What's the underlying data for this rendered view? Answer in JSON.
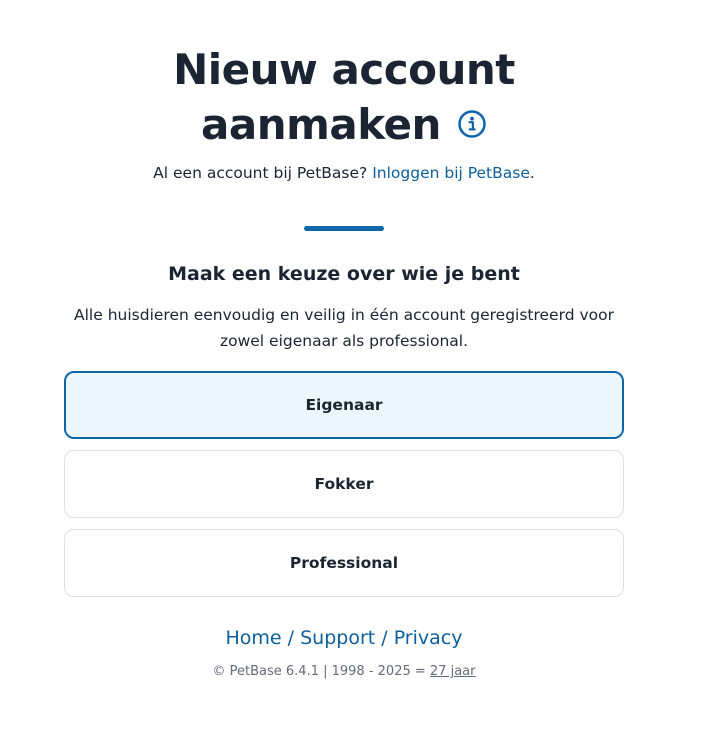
{
  "header": {
    "title_line1": "Nieuw account",
    "title_line2": "aanmaken",
    "info_icon": "info-circle-icon"
  },
  "login_prompt": {
    "text": "Al een account bij PetBase? ",
    "link": "Inloggen bij PetBase",
    "suffix": "."
  },
  "choice": {
    "heading": "Maak een keuze over wie je bent",
    "description": "Alle huisdieren eenvoudig en veilig in één account geregistreerd voor zowel eigenaar als professional.",
    "options": [
      {
        "label": "Eigenaar",
        "selected": true
      },
      {
        "label": "Fokker",
        "selected": false
      },
      {
        "label": "Professional",
        "selected": false
      }
    ]
  },
  "footer": {
    "links": [
      "Home",
      "Support",
      "Privacy"
    ],
    "separator": " / ",
    "copyright": "© PetBase 6.4.1 | 1998 - 2025 = ",
    "years": "27 jaar"
  },
  "colors": {
    "accent": "#0d66aa",
    "link": "#0d5e9c",
    "text": "#1b2432",
    "selected_bg": "#eef6fd",
    "border": "#dcdfe4",
    "muted": "#646b77"
  }
}
